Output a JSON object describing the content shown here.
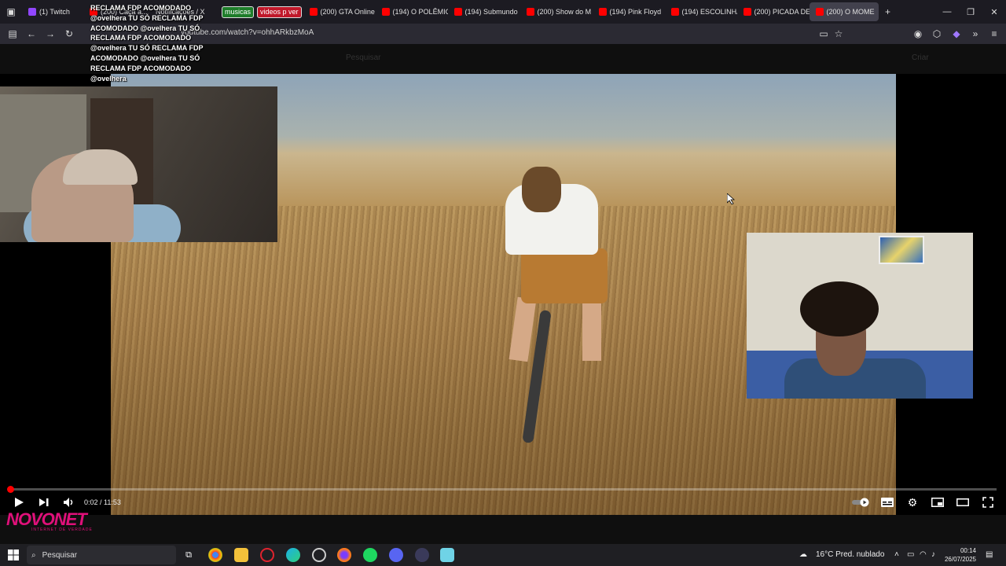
{
  "browser": {
    "tabs": [
      {
        "label": "(1) Twitch",
        "kind": "twitch"
      },
      {
        "label": "(200) Caça a...",
        "kind": "yt"
      },
      {
        "label": "Notificações / X",
        "kind": "x"
      },
      {
        "label": "(200) GTA Online",
        "kind": "yt"
      },
      {
        "label": "(194) O POLÊMIC",
        "kind": "yt"
      },
      {
        "label": "(194) Submundo",
        "kind": "yt"
      },
      {
        "label": "(200) Show do M",
        "kind": "yt"
      },
      {
        "label": "(194) Pink Floyd",
        "kind": "yt"
      },
      {
        "label": "(194) ESCOLINHA",
        "kind": "yt"
      },
      {
        "label": "(200) PICADA DE",
        "kind": "yt"
      },
      {
        "label": "(200) O MOME",
        "kind": "yt",
        "active": true
      }
    ],
    "bookmark_musicas": "musicas",
    "bookmark_videos": "videos p ver",
    "url": "youtube.com/watch?v=ohhARkbzMoA",
    "new_tab": "+"
  },
  "youtube": {
    "search_placeholder": "Pesquisar",
    "create_label": "Criar"
  },
  "chat_overlay": "RECLAMA FDP ACOMODADO @ovelhera TU SÓ RECLAMA FDP ACOMODADO @ovelhera TU SÓ RECLAMA FDP ACOMODADO @ovelhera TU SÓ RECLAMA FDP ACOMODADO @ovelhera TU SÓ RECLAMA FDP ACOMODADO @ovelhera",
  "player": {
    "time_current": "0:02",
    "time_total": "11:53",
    "time_text": "0:02 / 11:53",
    "progress_fraction": 0.003,
    "accent": "#ff0000"
  },
  "logo": {
    "name": "NOVONET",
    "tagline": "INTERNET DE VERDADE"
  },
  "taskbar": {
    "search_placeholder": "Pesquisar",
    "weather": "16°C  Pred. nublado",
    "time": "00:14",
    "date": "26/07/2025"
  }
}
